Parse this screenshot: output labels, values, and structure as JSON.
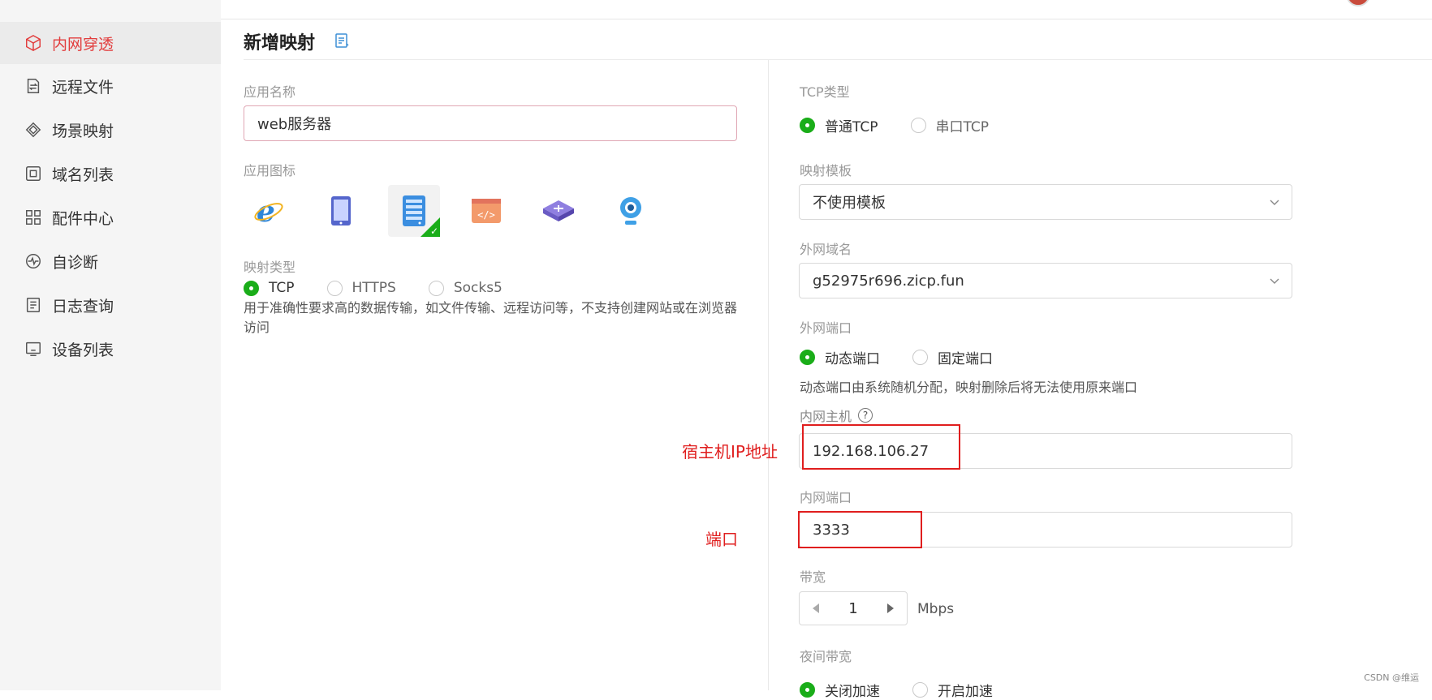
{
  "sidebar": {
    "items": [
      {
        "label": "内网穿透",
        "icon": "cube-icon",
        "active": true
      },
      {
        "label": "远程文件",
        "icon": "file-transfer-icon"
      },
      {
        "label": "场景映射",
        "icon": "scene-icon"
      },
      {
        "label": "域名列表",
        "icon": "domain-icon"
      },
      {
        "label": "配件中心",
        "icon": "grid-icon"
      },
      {
        "label": "自诊断",
        "icon": "pulse-icon"
      },
      {
        "label": "日志查询",
        "icon": "log-icon"
      },
      {
        "label": "设备列表",
        "icon": "monitor-icon"
      }
    ]
  },
  "header": {
    "title": "新增映射",
    "icon": "doc-icon"
  },
  "left": {
    "app_name_label": "应用名称",
    "app_name_value": "web服务器",
    "app_icon_label": "应用图标",
    "app_icons": [
      "ie-browser-icon",
      "tablet-icon",
      "server-icon",
      "code-icon",
      "router-icon",
      "webcam-icon"
    ],
    "selected_icon_index": 2,
    "mapping_type_label": "映射类型",
    "mapping_types": [
      "TCP",
      "HTTPS",
      "Socks5"
    ],
    "mapping_type_selected": "TCP",
    "mapping_desc": "用于准确性要求高的数据传输，如文件传输、远程访问等，不支持创建网站或在浏览器访问"
  },
  "right": {
    "tcp_type_label": "TCP类型",
    "tcp_types": [
      "普通TCP",
      "串口TCP"
    ],
    "tcp_type_selected": "普通TCP",
    "template_label": "映射模板",
    "template_value": "不使用模板",
    "domain_label": "外网域名",
    "domain_value": "g52975r696.zicp.fun",
    "port_label": "外网端口",
    "port_types": [
      "动态端口",
      "固定端口"
    ],
    "port_type_selected": "动态端口",
    "port_desc": "动态端口由系统随机分配，映射删除后将无法使用原来端口",
    "host_label": "内网主机",
    "host_help": "?",
    "host_value": "192.168.106.27",
    "inner_port_label": "内网端口",
    "inner_port_value": "3333",
    "bandwidth_label": "带宽",
    "bandwidth_value": "1",
    "bandwidth_unit": "Mbps",
    "night_label": "夜间带宽",
    "night_options": [
      "关闭加速",
      "开启加速"
    ],
    "night_selected": "关闭加速"
  },
  "annotations": {
    "host_note": "宿主机IP地址",
    "port_note": "端口",
    "color": "#e01e1e"
  },
  "watermark": "CSDN @维运",
  "colors": {
    "accent": "#e23d3d",
    "radio_checked": "#1aad19"
  }
}
